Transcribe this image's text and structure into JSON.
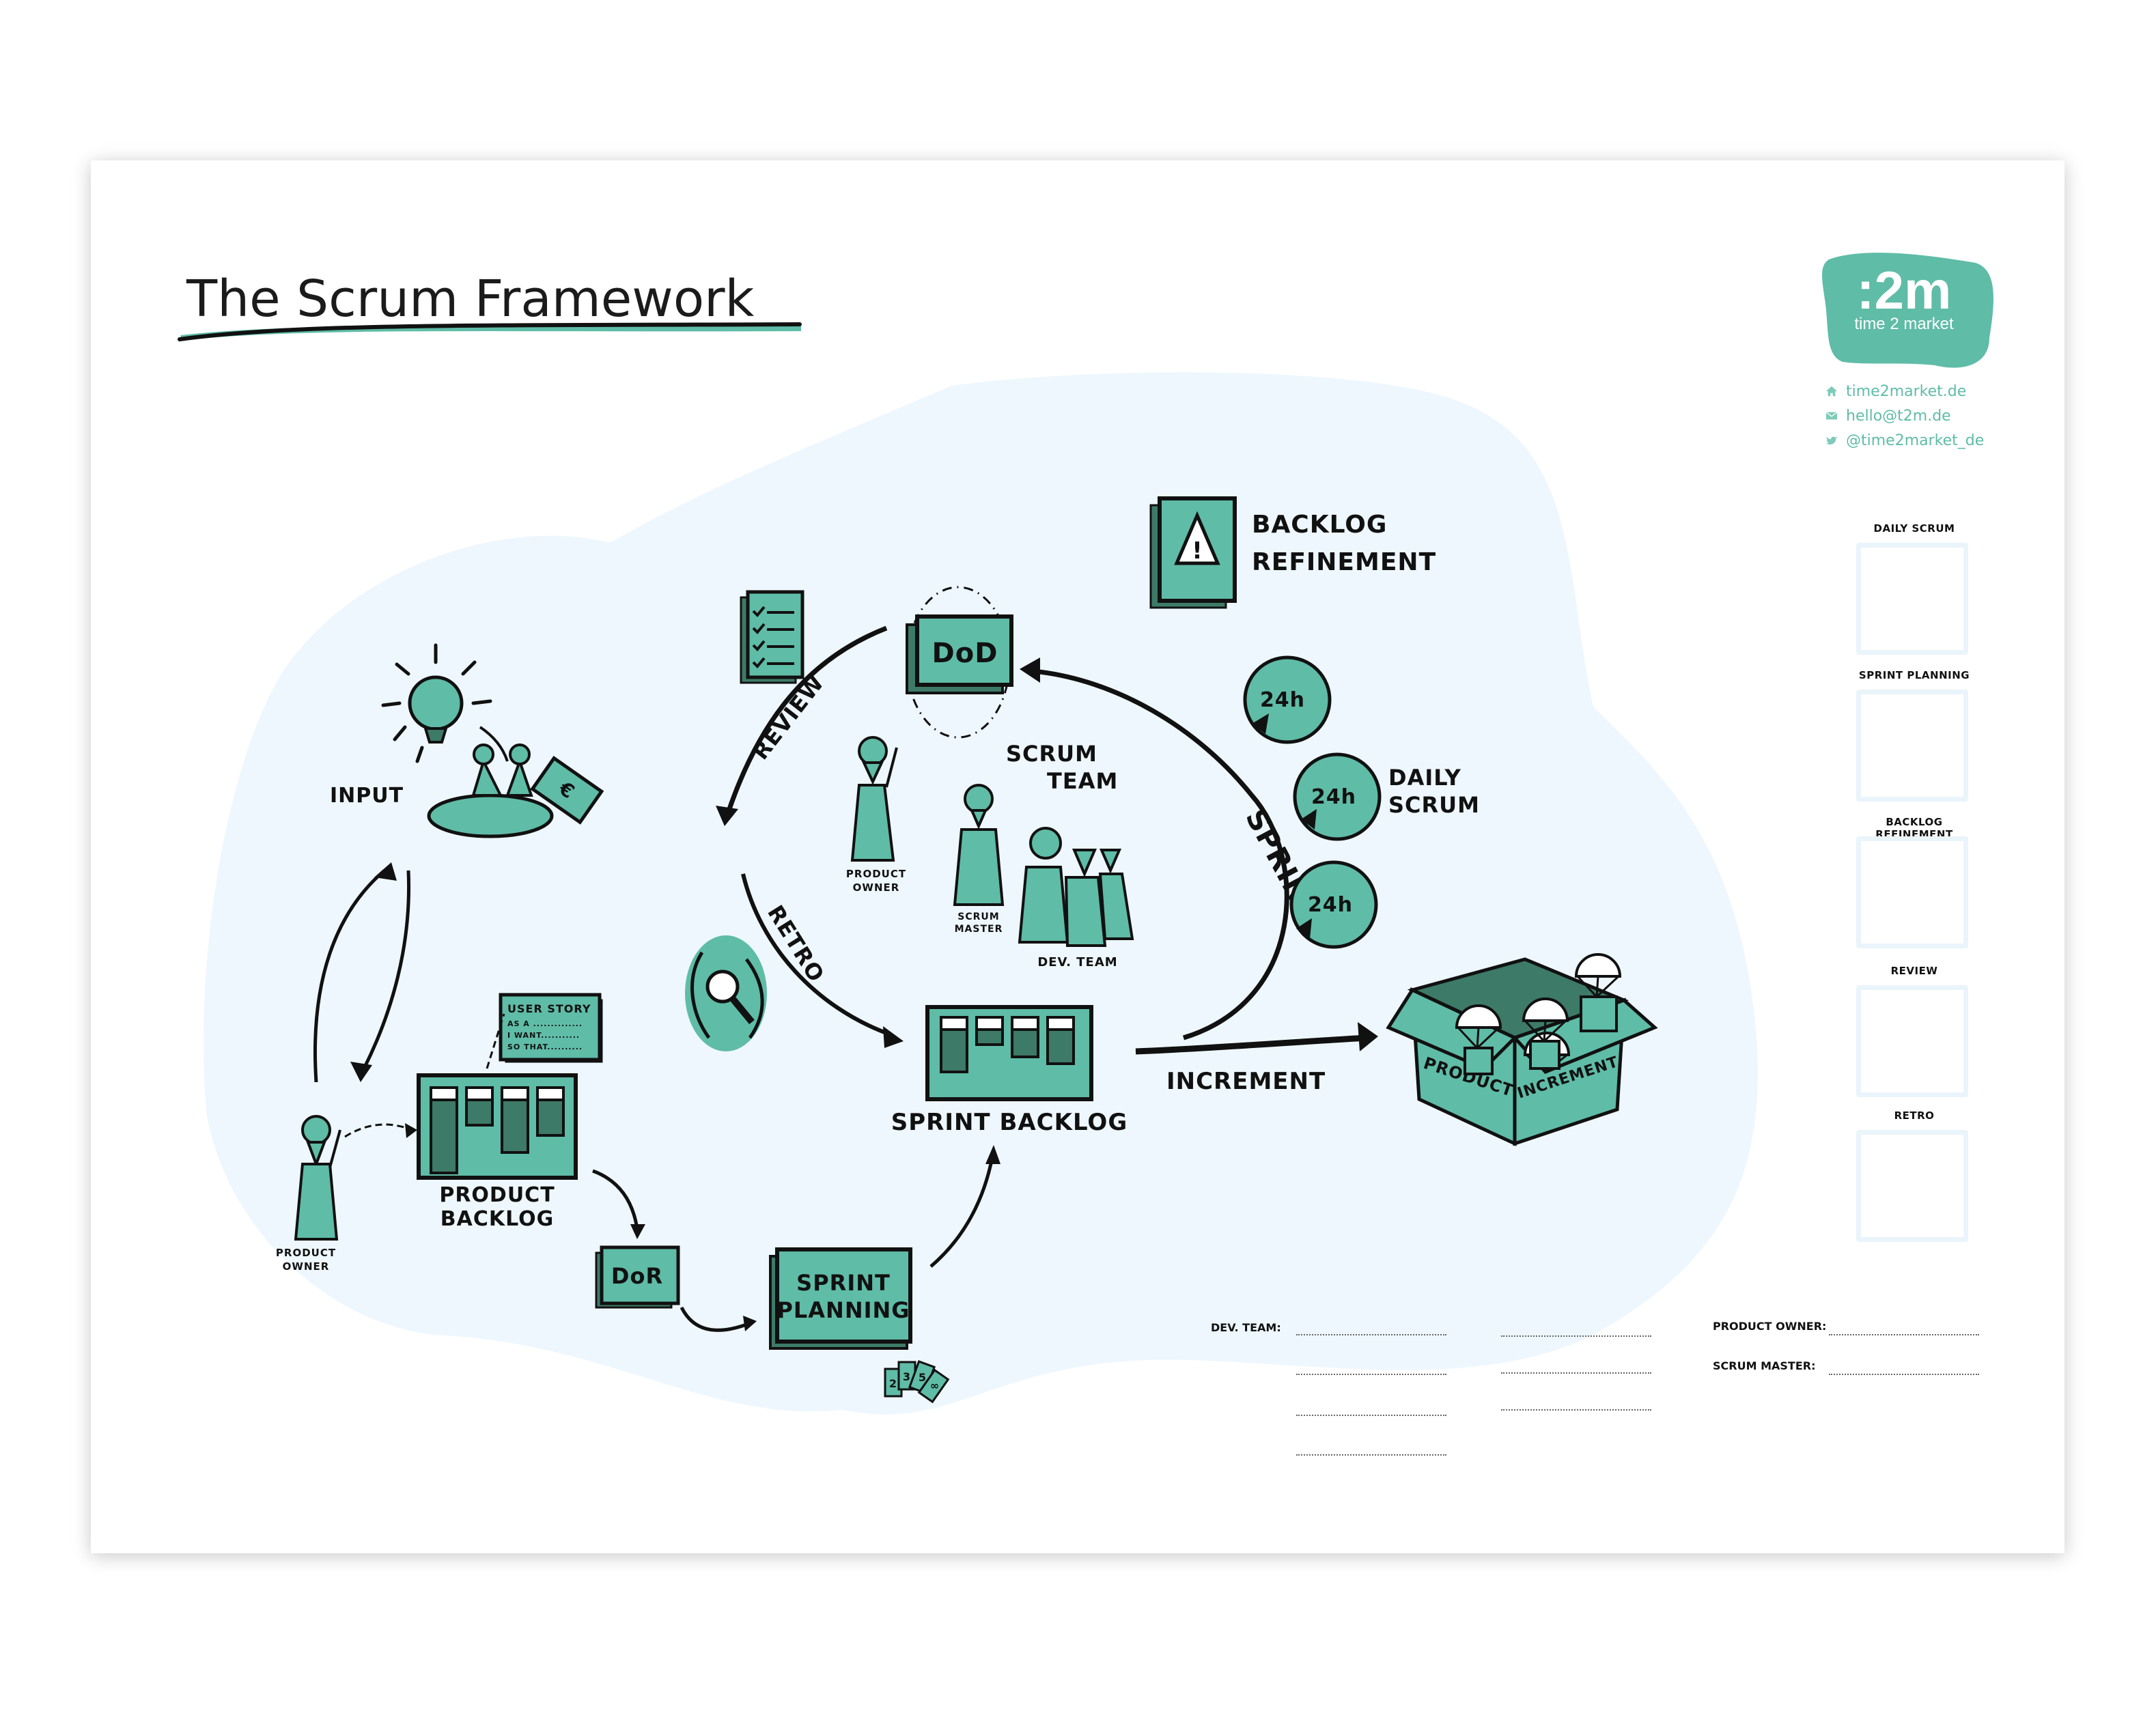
{
  "title": "The Scrum Framework",
  "brand": {
    "logo_main": ":2m",
    "logo_registered": "®",
    "logo_sub": "time 2 market",
    "color_teal": "#5fbca7",
    "color_dark_teal": "#3d7a68",
    "color_bg_blob": "#eef7fd",
    "contacts": [
      {
        "icon": "home-icon",
        "text": "time2market.de"
      },
      {
        "icon": "mail-icon",
        "text": "hello@t2m.de"
      },
      {
        "icon": "twitter-icon",
        "text": "@time2market_de"
      }
    ]
  },
  "diagram": {
    "input_label": "INPUT",
    "product_owner_label_line1": "PRODUCT",
    "product_owner_label_line2": "OWNER",
    "user_story": {
      "title": "USER STORY",
      "line1": "AS A ..............",
      "line2": "I WANT...........",
      "line3": "SO THAT.........."
    },
    "product_backlog_line1": "PRODUCT",
    "product_backlog_line2": "BACKLOG",
    "dor_label": "DoR",
    "sprint_planning_line1": "SPRINT",
    "sprint_planning_line2": "PLANNING",
    "estimation_cards": [
      "2",
      "3",
      "5",
      "∞"
    ],
    "sprint_backlog_label": "SPRINT BACKLOG",
    "retro_label": "RETRO",
    "review_label": "REVIEW",
    "dod_label": "DoD",
    "backlog_refinement_line1": "BACKLOG",
    "backlog_refinement_line2": "REFINEMENT",
    "sprint_label": "SPRINT",
    "daily_scrum_line1": "DAILY",
    "daily_scrum_line2": "SCRUM",
    "daily_cycles": [
      "24h",
      "24h",
      "24h"
    ],
    "scrum_team_line1": "SCRUM",
    "scrum_team_line2": "TEAM",
    "team_po_line1": "PRODUCT",
    "team_po_line2": "OWNER",
    "team_sm_line1": "SCRUM",
    "team_sm_line2": "MASTER",
    "team_dev": "DEV. TEAM",
    "increment_label": "INCREMENT",
    "box_left": "PRODUCT",
    "box_right": "INCREMENT"
  },
  "sidebar_boxes": [
    {
      "label": "Daily Scrum"
    },
    {
      "label": "Sprint Planning"
    },
    {
      "label": "Backlog Refinement"
    },
    {
      "label": "Review"
    },
    {
      "label": "Retro"
    }
  ],
  "signatures": {
    "dev_team_label": "DEV. TEAM:",
    "product_owner_label": "PRODUCT OWNER:",
    "scrum_master_label": "SCRUM MASTER:"
  }
}
